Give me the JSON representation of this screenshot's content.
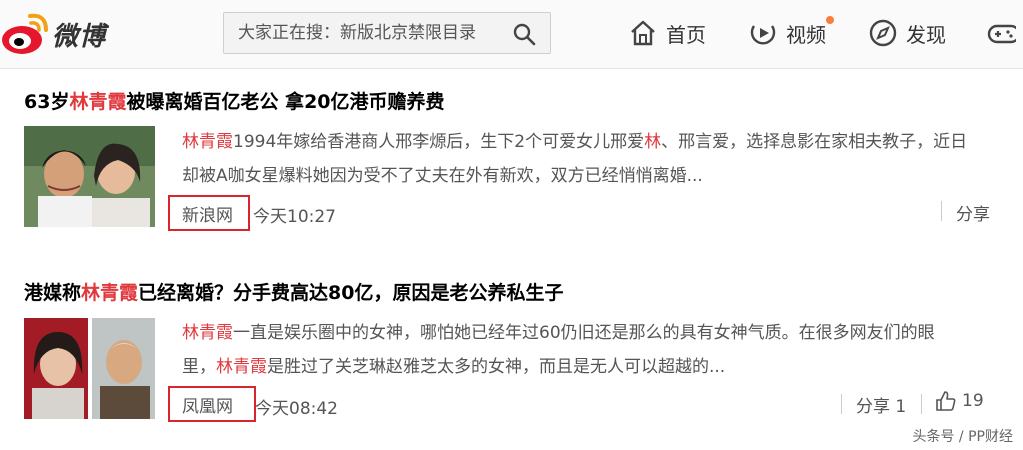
{
  "header": {
    "logo_text": "微博",
    "search": {
      "placeholder": "大家正在搜：新版北京禁限目录"
    },
    "nav": [
      {
        "label": "首页",
        "icon": "home-icon"
      },
      {
        "label": "视频",
        "icon": "video-icon"
      },
      {
        "label": "发现",
        "icon": "compass-icon"
      },
      {
        "label": "",
        "icon": "gamepad-icon"
      }
    ],
    "colors": {
      "brand_red": "#e6162d",
      "notification_dot": "#fa7d3c",
      "keyword_highlight": "#e0393e",
      "source_box_border": "#d9262e"
    }
  },
  "results": [
    {
      "title_pre": "63岁",
      "title_hl": "林青霞",
      "title_post": "被曝离婚百亿老公 拿20亿港币赡养费",
      "line1_hl": "林青霞",
      "line1_a": "1994年嫁给香港商人邢李㷧后，生下2个可爱女儿邢爱",
      "line1_hl2": "林",
      "line1_b": "、邢言爱，选择息影在家相夫教子，近日",
      "line2": "却被A咖女星爆料她因为受不了丈夫在外有新欢，双方已经悄悄离婚...",
      "source": "新浪网",
      "time": "今天10:27",
      "share": "分享"
    },
    {
      "title_pre": "港媒称",
      "title_hl": "林青霞",
      "title_post": "已经离婚？分手费高达80亿，原因是老公养私生子",
      "line1_hl": "林青霞",
      "line1_a": "一直是娱乐圈中的女神，哪怕她已经年过60仍旧还是那么的具有女神气质。在很多网友们的眼",
      "line2_pre": "里，",
      "line2_hl": "林青霞",
      "line2_post": "是胜过了关芝琳赵雅芝太多的女神，而且是无人可以超越的...",
      "source": "凤凰网",
      "time": "今天08:42",
      "share": "分享 1",
      "likes": "19"
    }
  ],
  "watermark": "头条号 / PP财经"
}
